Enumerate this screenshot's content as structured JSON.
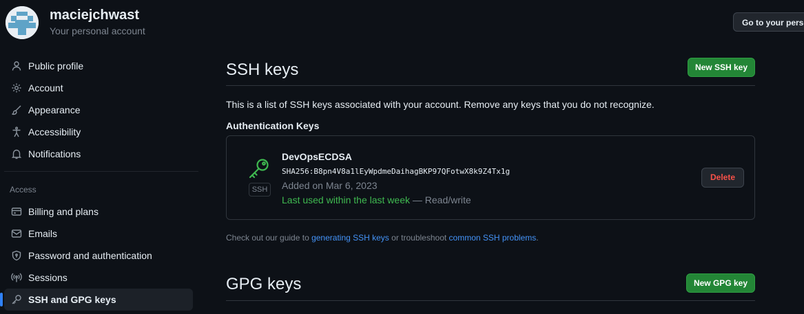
{
  "header": {
    "username": "maciejchwast",
    "subtitle": "Your personal account",
    "goto_button": "Go to your perso"
  },
  "sidebar": {
    "items_top": [
      {
        "label": "Public profile",
        "icon": "person-icon"
      },
      {
        "label": "Account",
        "icon": "gear-icon"
      },
      {
        "label": "Appearance",
        "icon": "paintbrush-icon"
      },
      {
        "label": "Accessibility",
        "icon": "accessibility-icon"
      },
      {
        "label": "Notifications",
        "icon": "bell-icon"
      }
    ],
    "section_label": "Access",
    "items_access": [
      {
        "label": "Billing and plans",
        "icon": "credit-card-icon"
      },
      {
        "label": "Emails",
        "icon": "mail-icon"
      },
      {
        "label": "Password and authentication",
        "icon": "shield-lock-icon"
      },
      {
        "label": "Sessions",
        "icon": "broadcast-icon"
      },
      {
        "label": "SSH and GPG keys",
        "icon": "key-icon",
        "active": true
      }
    ]
  },
  "ssh": {
    "title": "SSH keys",
    "new_button": "New SSH key",
    "intro": "This is a list of SSH keys associated with your account. Remove any keys that you do not recognize.",
    "auth_heading": "Authentication Keys",
    "keys": [
      {
        "name": "DevOpsECDSA",
        "fingerprint": "SHA256:B8pn4V8a1lEyWpdmeDaihagBKP97QFotwX8k9Z4Tx1g",
        "added": "Added on Mar 6, 2023",
        "last_used": "Last used within the last week",
        "access": " — Read/write",
        "badge": "SSH",
        "delete_label": "Delete"
      }
    ],
    "guide_prefix": "Check out our guide to ",
    "guide_link1": "generating SSH keys",
    "guide_mid": " or troubleshoot ",
    "guide_link2": "common SSH problems",
    "guide_suffix": "."
  },
  "gpg": {
    "title": "GPG keys",
    "new_button": "New GPG key"
  },
  "colors": {
    "background": "#0d1117",
    "accent_green": "#238636",
    "link_blue": "#4493f8",
    "danger_red": "#f85149",
    "success_green": "#3fb950"
  }
}
